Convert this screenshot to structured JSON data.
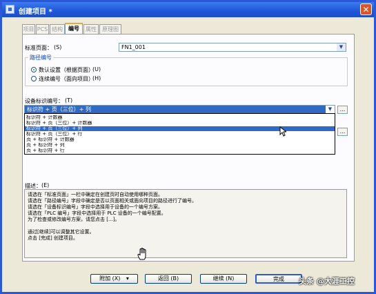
{
  "window": {
    "title": "创建项目 *",
    "close_glyph": "✕"
  },
  "tabs": [
    {
      "label": "项目"
    },
    {
      "label": "PCS"
    },
    {
      "label": "结构"
    },
    {
      "label": "编号"
    },
    {
      "label": "属性"
    },
    {
      "label": "原理图"
    }
  ],
  "form": {
    "standard_page_label": "标准页面：",
    "standard_page_shortcut": "(S)",
    "standard_page_value": "FN1_001",
    "path_numbering_title": "路径编号",
    "radio_default": "数认设置（根据页面）",
    "radio_default_shortcut": "(U)",
    "radio_continuous": "连续编号（面向项目）",
    "radio_continuous_shortcut": "(H)",
    "device_id_label": "设备标识编号：",
    "device_id_shortcut": "(T)",
    "device_id_value": "标识符 + 页（三位）+ 列",
    "dots": "...",
    "dropdown_options": [
      "标识符 + 计数器",
      "标识符 + 页（三位）+ 计数器",
      "标识符 + 页（三位）+ 列",
      "标识符 + 页（三位）+ 行",
      "页 + 标识符 + 计数器",
      "页 + 标识符 + 列",
      "页 + 标识符 + 行"
    ],
    "dropdown_selected_index": 2
  },
  "description": {
    "label": "描述：",
    "shortcut": "(E)",
    "lines": [
      "请选在「标准页面」一栏中确定在创建页时自动使用哪种页面。",
      "请选在「路径编号」字段中确定是否以页面相关或面向项目的路径进行了编号。",
      "请选在「设备标识编号」字段中选择用于设备的一个编号方案。",
      "请选在「PLC 编号」字段中选择用于 PLC 设备的一个编号配置。",
      "为了检查或修改编号方案，请您点击 [...]。",
      "",
      "通过[继续]可以调整其它设置。",
      "点击 [完成] 创建项目。"
    ]
  },
  "buttons": {
    "extra": "附加 (X)",
    "extra_arrow": "▾",
    "back": "返回 (B)",
    "next": "继续 (N)",
    "finish": "完成"
  },
  "watermark": "头条 @大涯工控",
  "colors": {
    "title_bar": "#1f56d8",
    "selection": "#316ac5",
    "group_title": "#0a40b0",
    "radio_dot": "#2aa02a"
  }
}
